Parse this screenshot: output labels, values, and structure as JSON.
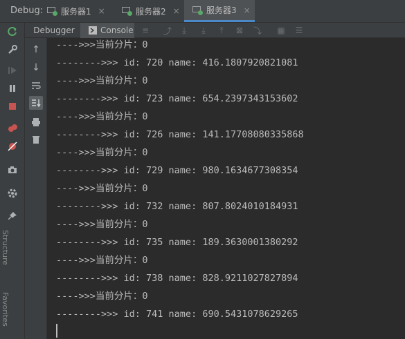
{
  "debug_bar": {
    "title": "Debug:",
    "tabs": [
      {
        "label": "服务器1",
        "active": false
      },
      {
        "label": "服务器2",
        "active": false
      },
      {
        "label": "服务器3",
        "active": true
      }
    ],
    "close_glyph": "×"
  },
  "sub_toolbar": {
    "tabs": [
      {
        "label": "Debugger",
        "active": false
      },
      {
        "label": "Console",
        "active": true
      }
    ]
  },
  "side_labels": [
    "Structure",
    "Favorites"
  ],
  "console": {
    "lines": [
      "---->>>当前分片：0",
      "-------->>> id: 720 name: 416.1807920821081",
      "---->>>当前分片：0",
      "-------->>> id: 723 name: 654.2397343153602",
      "---->>>当前分片：0",
      "-------->>> id: 726 name: 141.17708080335868",
      "---->>>当前分片：0",
      "-------->>> id: 729 name: 980.1634677308354",
      "---->>>当前分片：0",
      "-------->>> id: 732 name: 807.8024010184931",
      "---->>>当前分片：0",
      "-------->>> id: 735 name: 189.3630001380292",
      "---->>>当前分片：0",
      "-------->>> id: 738 name: 828.9211027827894",
      "---->>>当前分片：0",
      "-------->>> id: 741 name: 690.5431078629265"
    ]
  },
  "colors": {
    "panel": "#3c3f41",
    "editor": "#2b2b2b",
    "text": "#bbbbbb",
    "accent_blue": "#4a88c7",
    "green": "#59a869",
    "red": "#c75450"
  }
}
